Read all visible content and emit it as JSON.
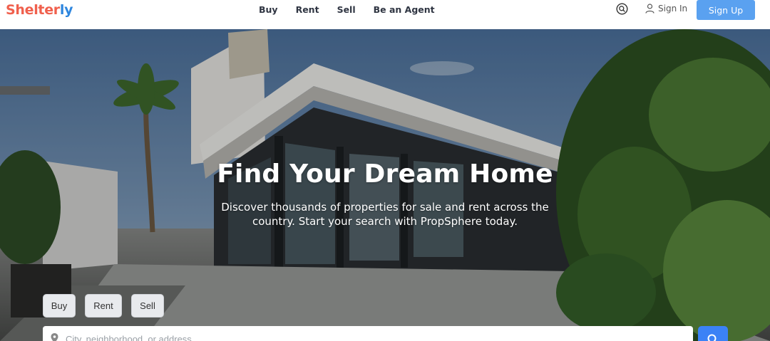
{
  "brand": {
    "part1": "Shelter",
    "part2": "ly"
  },
  "nav": {
    "items": [
      "Buy",
      "Rent",
      "Sell",
      "Be an Agent"
    ]
  },
  "header": {
    "signin_label": "Sign In",
    "signup_label": "Sign Up"
  },
  "hero": {
    "title": "Find Your Dream Home",
    "subtitle": "Discover thousands of properties for sale and rent across the country. Start your search with PropSphere today."
  },
  "search": {
    "tabs": [
      "Buy",
      "Rent",
      "Sell"
    ],
    "placeholder": "City, neighborhood, or address"
  },
  "colors": {
    "brand_red": "#f0604d",
    "brand_blue": "#2e86de",
    "signup_bg": "#5aa1f0",
    "search_button": "#3b82f6"
  },
  "icons": {
    "header_search": "search-circle-icon",
    "signin": "user-icon",
    "search_field": "location-pin-icon",
    "search_button": "search-icon"
  }
}
